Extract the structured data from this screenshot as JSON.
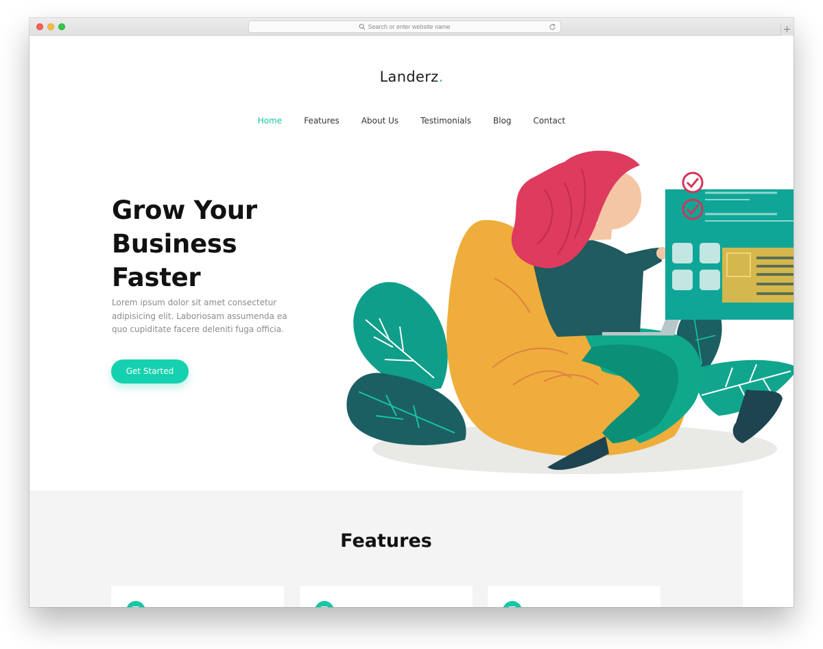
{
  "browser": {
    "address_placeholder": "Search or enter website name",
    "new_tab_glyph": "+"
  },
  "site": {
    "logo_text": "Landerz",
    "logo_dot": ".",
    "nav": [
      {
        "label": "Home",
        "active": true
      },
      {
        "label": "Features",
        "active": false
      },
      {
        "label": "About Us",
        "active": false
      },
      {
        "label": "Testimonials",
        "active": false
      },
      {
        "label": "Blog",
        "active": false
      },
      {
        "label": "Contact",
        "active": false
      }
    ]
  },
  "hero": {
    "title_lines": [
      "Grow Your",
      "Business",
      "Faster"
    ],
    "description": "Lorem ipsum dolor sit amet consectetur adipisicing elit. Laboriosam assumenda ea quo cupiditate facere deleniti fuga officia.",
    "cta_label": "Get Started"
  },
  "features": {
    "title": "Features",
    "card_count": 3
  },
  "colors": {
    "accent": "#16c6a4",
    "cta": "#15d1b0",
    "features_bg": "#f4f4f4"
  }
}
